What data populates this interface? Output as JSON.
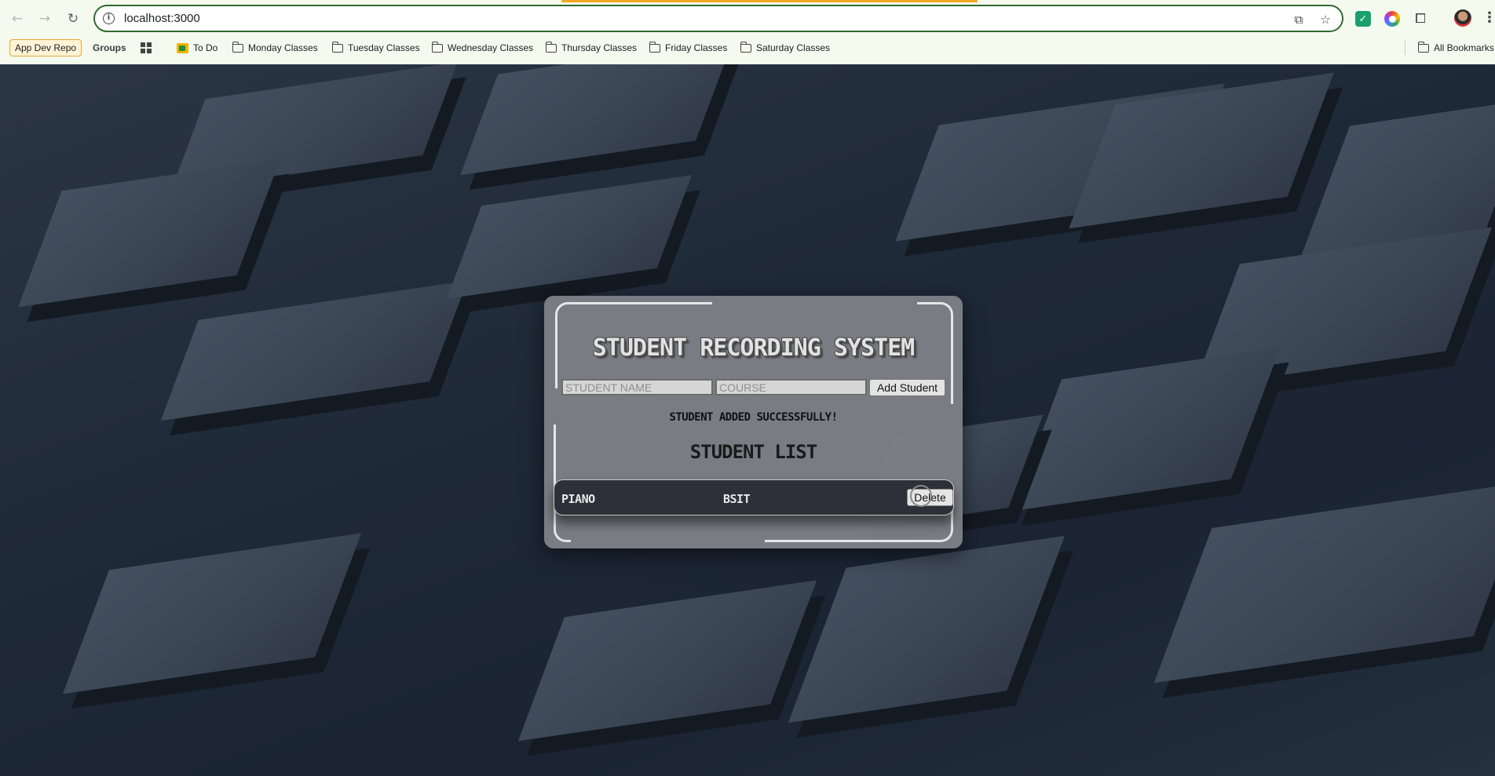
{
  "browser": {
    "url": "localhost:3000",
    "bookmarks": [
      "App Dev Repo",
      "Groups",
      "To Do",
      "Monday Classes",
      "Tuesday Classes",
      "Wednesday Classes",
      "Thursday Classes",
      "Friday Classes",
      "Saturday Classes"
    ],
    "all_bookmarks_label": "All Bookmarks"
  },
  "app": {
    "title": "STUDENT RECORDING SYSTEM",
    "name_placeholder": "STUDENT NAME",
    "course_placeholder": "COURSE",
    "name_value": "",
    "course_value": "",
    "add_button": "Add Student",
    "success_message": "STUDENT ADDED SUCCESSFULLY!",
    "list_title": "STUDENT LIST",
    "students": [
      {
        "name": "PIANO",
        "course": "BSIT",
        "delete_label": "Delete"
      }
    ]
  }
}
